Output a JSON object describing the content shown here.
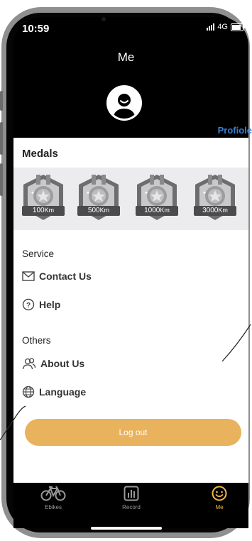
{
  "status_bar": {
    "time": "10:59",
    "network": "4G"
  },
  "header": {
    "title": "Me",
    "profile_link": "Profiole"
  },
  "medals": {
    "label": "Medals",
    "items": [
      {
        "distance": "100",
        "unit": "Km"
      },
      {
        "distance": "500",
        "unit": "Km"
      },
      {
        "distance": "1000",
        "unit": "Km"
      },
      {
        "distance": "3000",
        "unit": "Km"
      }
    ]
  },
  "service": {
    "label": "Service",
    "items": [
      {
        "label": "Contact Us",
        "icon": "mail-icon"
      },
      {
        "label": "Help",
        "icon": "question-circle-icon"
      }
    ]
  },
  "others": {
    "label": "Others",
    "items": [
      {
        "label": "About Us",
        "icon": "people-icon"
      },
      {
        "label": "Language",
        "icon": "globe-icon"
      }
    ]
  },
  "logout": {
    "label": "Log out",
    "color": "#e9b25c"
  },
  "tab_bar": {
    "active": "Me",
    "active_color": "#f0b948",
    "tabs": [
      {
        "label": "Ebikes",
        "icon": "bike-icon"
      },
      {
        "label": "Record",
        "icon": "bar-chart-icon"
      },
      {
        "label": "Me",
        "icon": "smiley-icon"
      }
    ]
  },
  "colors": {
    "profile_link": "#3d7fcf",
    "background": "#000000"
  }
}
